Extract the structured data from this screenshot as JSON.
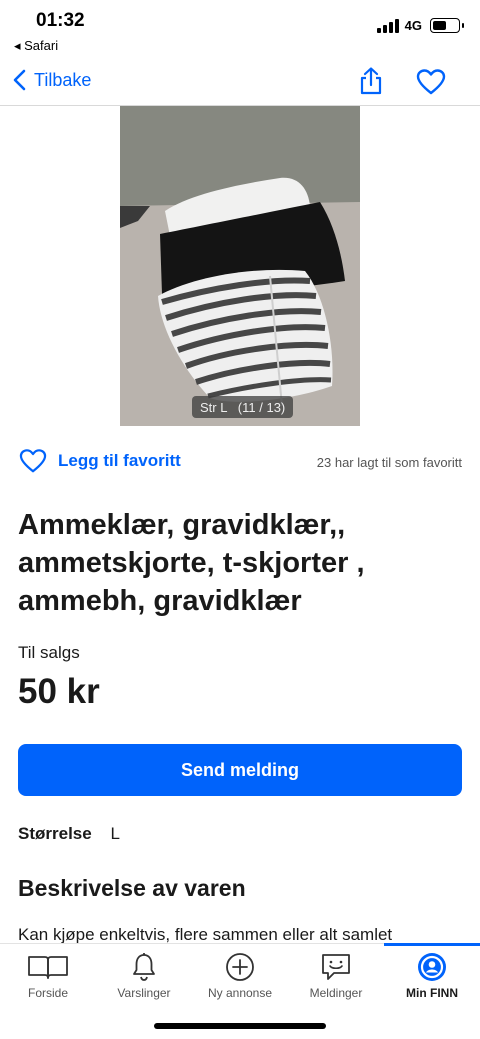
{
  "status_bar": {
    "time": "01:32",
    "back_app": "◂ Safari",
    "network": "4G",
    "battery_level": 0.45
  },
  "nav": {
    "back_label": "Tilbake"
  },
  "gallery": {
    "counter": "Str L   (11 / 13)"
  },
  "favorite": {
    "add_label": "Legg til favoritt",
    "count_text": "23 har lagt til som favoritt"
  },
  "listing": {
    "title": "Ammeklær, gravidklær,, ammetskjorte, t-skjorter , ammebh, gravidklær",
    "status": "Til salgs",
    "price": "50 kr"
  },
  "actions": {
    "send_message": "Send melding"
  },
  "attributes": {
    "size_label": "Størrelse",
    "size_value": "L"
  },
  "description": {
    "heading": "Beskrivelse av varen",
    "text": "Kan kjøpe enkeltvis, flere sammen eller alt samlet"
  },
  "tab_bar": {
    "items": [
      {
        "label": "Forside",
        "icon": "book-icon"
      },
      {
        "label": "Varslinger",
        "icon": "bell-icon"
      },
      {
        "label": "Ny annonse",
        "icon": "plus-circle-icon"
      },
      {
        "label": "Meldinger",
        "icon": "chat-icon"
      },
      {
        "label": "Min FINN",
        "icon": "profile-icon"
      }
    ],
    "active_index": 4
  },
  "colors": {
    "accent": "#0063fb",
    "text": "#1a1a1a"
  }
}
